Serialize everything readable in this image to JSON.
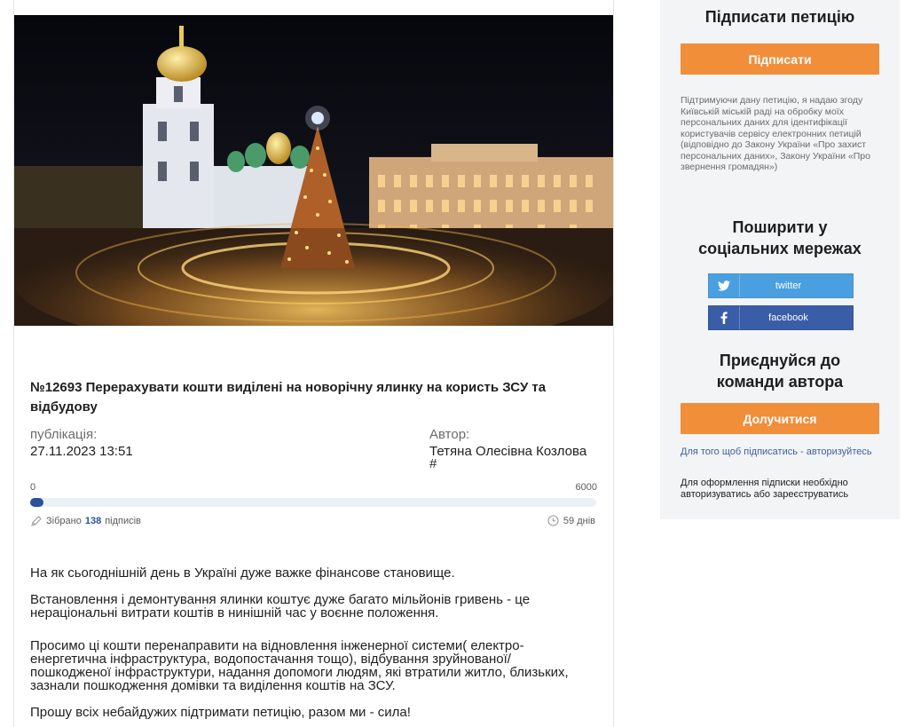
{
  "petition": {
    "title": "№12693 Перерахувати кошти виділені на новорічну ялинку на користь ЗСУ та відбудову",
    "publication_label": "публікація:",
    "publication_date": "27.11.2023 13:51",
    "author_label": "Автор:",
    "author_name": "Тетяна Олесівна Козлова",
    "author_suffix": "#",
    "image_alt": "christmas-tree-sofia-square-night",
    "progress": {
      "min": "0",
      "max": "6000",
      "collected": 138,
      "target": 6000,
      "collected_prefix": "Зібрано",
      "collected_count": "138",
      "collected_suffix": "підписів",
      "days_left": "59 днів"
    },
    "body": [
      "На як сьогоднішній день в Україні дуже важке фінансове становище.",
      "Встановлення і демонтування ялинки коштує дуже багато мільйонів гривень - це нераціональні витрати коштів в нинішній час у воєнне положення.",
      "Просимо ці кошти перенаправити на відновлення інженерної системи( електро-енергетична інфраструктура, водопостачання тощо), відбування зруйнованої/пошкодженої інфраструктури, надання допомоги людям, які втратили житло, близьких, зазнали пошкодження домівки та виділення коштів на ЗСУ.",
      "Прошу всіх небайдужих підтримати петицію, разом ми - сила!"
    ]
  },
  "sidebar": {
    "sign_heading": "Підписати петицію",
    "sign_button": "Підписати",
    "consent_text": "Підтримуючи дану петицію, я надаю згоду Київській міській раді на обробку моїх персональних даних для ідентифікації користувачів сервісу електронних петицій (відповідно до Закону України «Про захист персональних даних», Закону України «Про звернення громадян»)",
    "share_heading": "Поширити у соціальних мережах",
    "twitter_label": "twitter",
    "facebook_label": "facebook",
    "join_heading": "Приєднуйся до команди автора",
    "join_button": "Долучитися",
    "auth_link": "Для того щоб підписатись - авторизуйтесь",
    "auth_note": "Для оформлення підписки необхідно авторизуватись або зареєструватись"
  },
  "colors": {
    "accent_orange": "#f08e3a",
    "progress_blue": "#29529b",
    "twitter_blue": "#4a9fe0",
    "facebook_blue": "#3a5da8",
    "sidebar_bg": "#f3f4f6"
  }
}
